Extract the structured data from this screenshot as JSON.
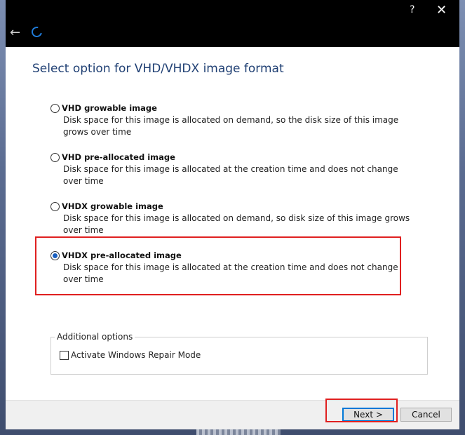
{
  "titlebar": {
    "help_label": "?",
    "close_label": "✕",
    "back_label": "←"
  },
  "heading": "Select option for VHD/VHDX image format",
  "options": [
    {
      "title": "VHD growable image",
      "desc": "Disk space for this image is allocated on demand, so the disk size of this image grows over time",
      "selected": false
    },
    {
      "title": "VHD pre-allocated image",
      "desc": "Disk space for this image is allocated at the creation time and does not change over time",
      "selected": false
    },
    {
      "title": "VHDX growable image",
      "desc": "Disk space for this image is allocated on demand, so disk size of this image grows over time",
      "selected": false
    },
    {
      "title": "VHDX pre-allocated image",
      "desc": "Disk space for this image is allocated at the creation time and does not change over time",
      "selected": true
    }
  ],
  "additional": {
    "legend": "Additional options",
    "repair_label": "Activate Windows Repair Mode",
    "repair_checked": false
  },
  "footer": {
    "next_label": "Next >",
    "cancel_label": "Cancel"
  },
  "colors": {
    "accent": "#1f3f73",
    "highlight": "#e02020",
    "titlebar": "#000000"
  }
}
